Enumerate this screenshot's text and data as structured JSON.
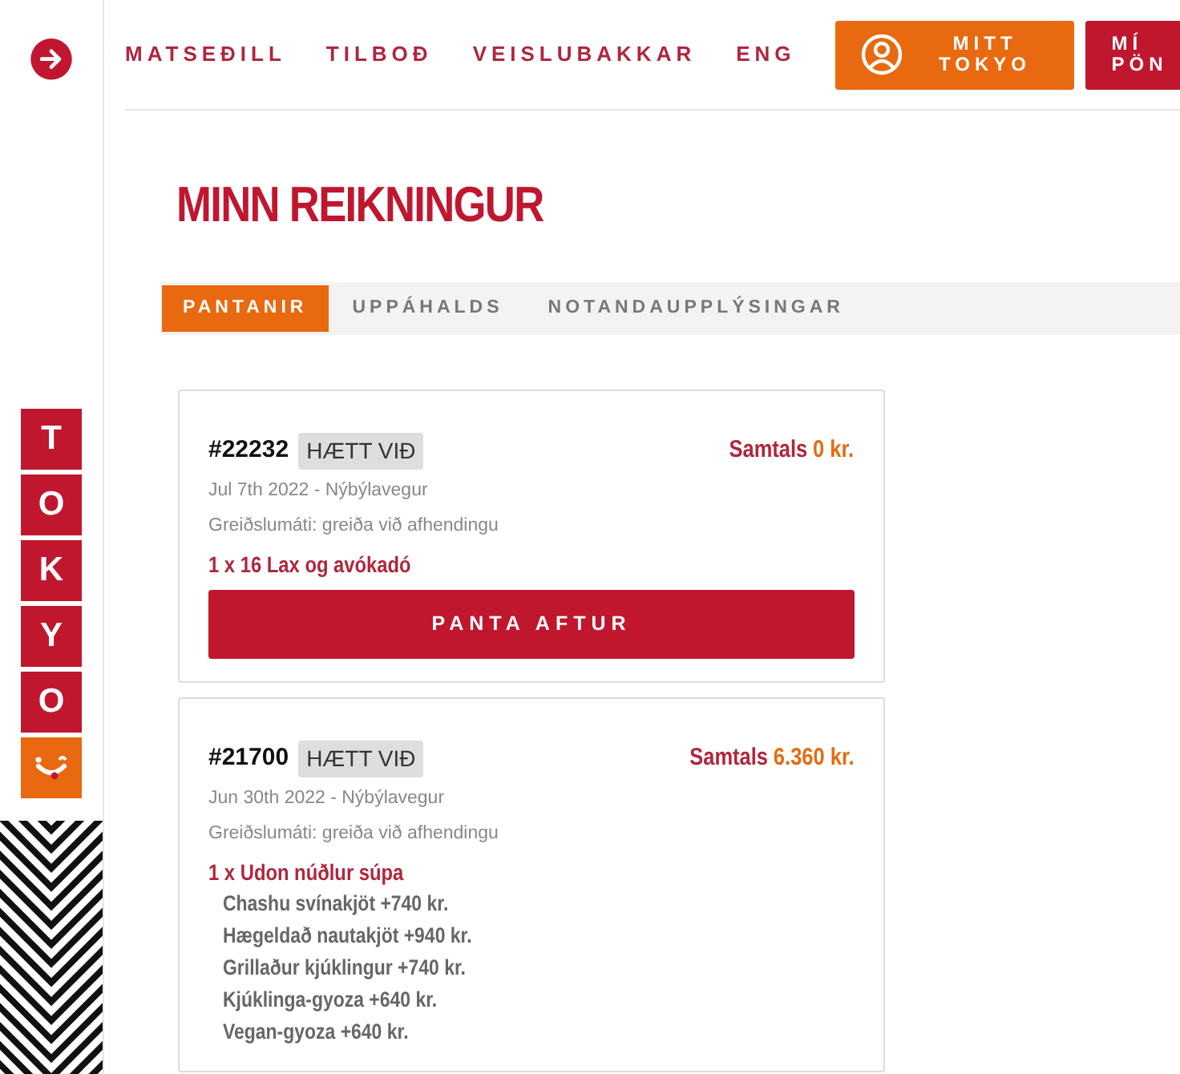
{
  "sidebar": {
    "logo_letters": [
      "T",
      "O",
      "K",
      "Y",
      "O"
    ]
  },
  "nav": {
    "links": [
      {
        "label": "MATSEÐILL"
      },
      {
        "label": "TILBOÐ"
      },
      {
        "label": "VEISLUBAKKAR"
      },
      {
        "label": "ENG"
      }
    ],
    "buttons": [
      {
        "label": "MITT TOKYO",
        "kind": "account"
      },
      {
        "label": "MÍ PÖN",
        "kind": "plain"
      }
    ]
  },
  "page_title": "MINN REIKNINGUR",
  "tabs": [
    {
      "label": "PANTANIR",
      "selected": true
    },
    {
      "label": "UPPÁHALDS",
      "selected": false
    },
    {
      "label": "NOTANDAUPPLÝSINGAR",
      "selected": false
    }
  ],
  "orders": [
    {
      "number": "#22232",
      "status": "HÆTT VIÐ",
      "date_place": "Jul 7th 2022 - Nýbýlavegur",
      "payment": "Greiðslumáti: greiða við afhendingu",
      "total_label": "Samtals",
      "total": "0 kr.",
      "items": [
        {
          "line": "1 x 16 Lax og avókadó"
        }
      ],
      "reorder_button": "PANTA AFTUR"
    },
    {
      "number": "#21700",
      "status": "HÆTT VIÐ",
      "date_place": "Jun 30th 2022 - Nýbýlavegur",
      "payment": "Greiðslumáti: greiða við afhendingu",
      "total_label": "Samtals",
      "total": "6.360 kr.",
      "items": [
        {
          "line": "1 x Udon núðlur súpa",
          "options": [
            "Chashu svínakjöt +740 kr.",
            "Hægeldað nautakjöt +940 kr.",
            "Grillaður kjúklingur +740 kr.",
            "Kjúklinga-gyoza +640 kr.",
            "Vegan-gyoza +640 kr."
          ]
        }
      ]
    }
  ]
}
